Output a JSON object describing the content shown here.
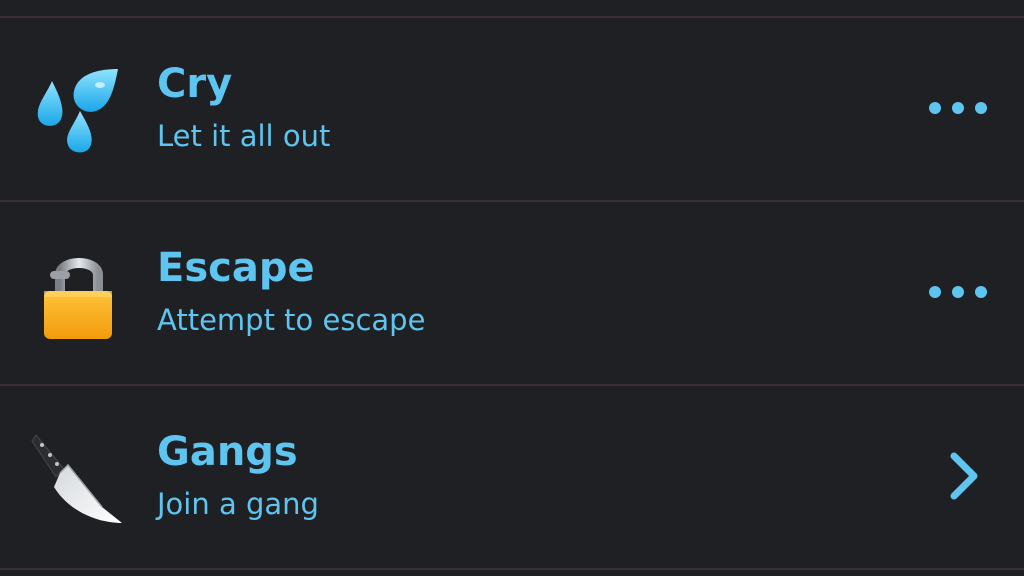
{
  "theme": {
    "background": "#1f2023",
    "divider": "#3a2d36",
    "accent": "#5ec4f0"
  },
  "actions": [
    {
      "title": "Cry",
      "subtitle": "Let it all out",
      "icon": "sweat-droplets-icon",
      "action_icon": "more-options-icon"
    },
    {
      "title": "Escape",
      "subtitle": "Attempt to escape",
      "icon": "unlocked-padlock-icon",
      "action_icon": "more-options-icon"
    },
    {
      "title": "Gangs",
      "subtitle": "Join a gang",
      "icon": "kitchen-knife-icon",
      "action_icon": "chevron-right-icon"
    }
  ]
}
